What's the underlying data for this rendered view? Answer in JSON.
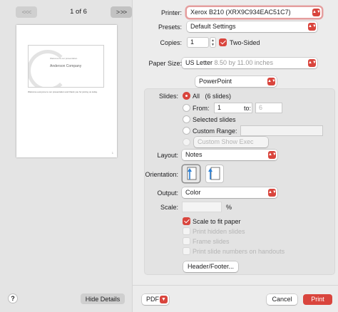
{
  "preview": {
    "page_indicator": "1 of 6",
    "prev_glyph": "<<<",
    "next_glyph": "> >>",
    "slide_subtitle": "Welcome to our presentation",
    "slide_title": "Anderson Company",
    "slide_note": "Welcome everyone to our presentation and thank you for joining us today.",
    "page_number": "1"
  },
  "footer_left": {
    "help_label": "?",
    "hide_details_label": "Hide Details"
  },
  "form": {
    "printer_label": "Printer:",
    "printer_value": "Xerox B210 (XRX9C934EAC51C7)",
    "presets_label": "Presets:",
    "presets_value": "Default Settings",
    "copies_label": "Copies:",
    "copies_value": "1",
    "two_sided_label": "Two-Sided",
    "paper_size_label": "Paper Size:",
    "paper_size_value": "US Letter",
    "paper_size_detail": "8.50 by 11.00 inches",
    "app_section_value": "PowerPoint"
  },
  "powerpoint": {
    "slides_label": "Slides:",
    "all_label": "All",
    "all_count": "(6 slides)",
    "from_label": "From:",
    "from_value": "1",
    "to_label": "to:",
    "to_value": "6",
    "selected_slides_label": "Selected slides",
    "custom_range_label": "Custom Range:",
    "custom_show_label": "Custom Show Exec",
    "layout_label": "Layout:",
    "layout_value": "Notes",
    "orientation_label": "Orientation:",
    "output_label": "Output:",
    "output_value": "Color",
    "scale_label": "Scale:",
    "scale_unit": "%",
    "scale_to_fit_label": "Scale to fit paper",
    "print_hidden_label": "Print hidden slides",
    "frame_slides_label": "Frame slides",
    "print_slide_numbers_label": "Print slide numbers on handouts",
    "header_footer_label": "Header/Footer..."
  },
  "bottom": {
    "pdf_label": "PDF",
    "cancel_label": "Cancel",
    "print_label": "Print"
  },
  "colors": {
    "accent": "#d9453d",
    "focus_ring": "#e59e9e"
  }
}
